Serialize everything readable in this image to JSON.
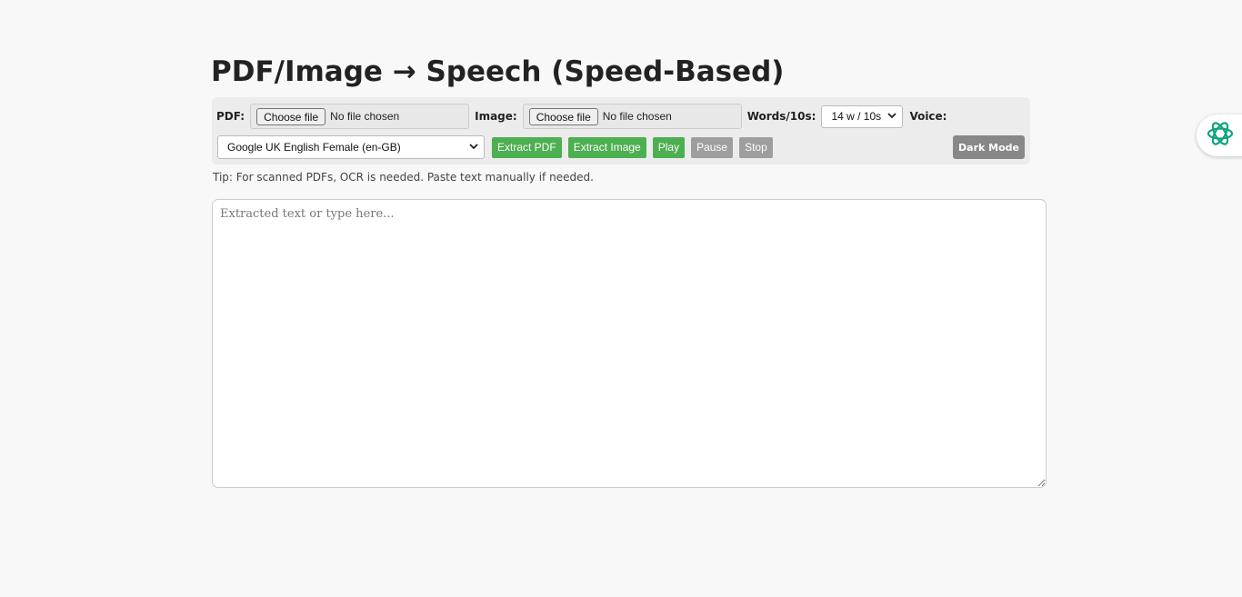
{
  "header": {
    "title": "PDF/Image → Speech (Speed-Based)"
  },
  "controls": {
    "pdf_label": "PDF:",
    "pdf_file": {
      "button": "Choose file",
      "status": "No file chosen"
    },
    "image_label": "Image:",
    "image_file": {
      "button": "Choose file",
      "status": "No file chosen"
    },
    "speed_label": "Words/10s:",
    "speed_select": {
      "selected": "14 w / 10s"
    },
    "voice_label": "Voice:",
    "voice_select": {
      "selected": "Google UK English Female (en-GB)"
    },
    "buttons": {
      "extract_pdf": "Extract PDF",
      "extract_image": "Extract Image",
      "play": "Play",
      "pause": "Pause",
      "stop": "Stop",
      "dark_mode": "Dark Mode"
    }
  },
  "tip": "Tip: For scanned PDFs, OCR is needed. Paste text manually if needed.",
  "editor": {
    "value": "",
    "placeholder": "Extracted text or type here..."
  },
  "icons": {
    "assistant": "assistant-knot-icon",
    "dropdown": "chevron-down-icon"
  },
  "colors": {
    "background": "#f8f8f8",
    "controls_bg": "#ececec",
    "action_green": "#4caf50",
    "disabled_grey": "#9e9e9e",
    "dark_mode_button": "#888888",
    "assistant_icon": "#10a37f"
  }
}
